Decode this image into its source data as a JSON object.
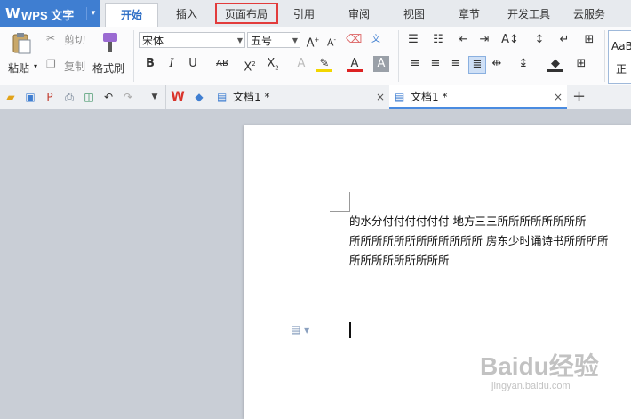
{
  "app": {
    "name": "WPS 文字",
    "logo_glyph": "W"
  },
  "menu_tabs": [
    {
      "label": "开始",
      "active": true
    },
    {
      "label": "插入"
    },
    {
      "label": "页面布局",
      "highlighted": true
    },
    {
      "label": "引用"
    },
    {
      "label": "审阅"
    },
    {
      "label": "视图"
    },
    {
      "label": "章节"
    },
    {
      "label": "开发工具"
    },
    {
      "label": "云服务"
    }
  ],
  "ribbon": {
    "paste": "粘贴",
    "cut": "剪切",
    "copy": "复制",
    "format_painter": "格式刷",
    "font_name": "宋体",
    "font_size": "五号",
    "style_preview": "AaB",
    "style_preview_2": "正"
  },
  "doc_tabs": [
    {
      "label": "文档1 *"
    },
    {
      "label": "文档1 *",
      "active": true
    }
  ],
  "document": {
    "lines": [
      "的水分付付付付付付  地方三三所所所所所所所所",
      "所所所所所所所所所所所所 房东少时诵诗书所所所所",
      "所所所所所所所所所"
    ]
  },
  "watermark": {
    "main": "Baidu经验",
    "sub": "jingyan.baidu.com"
  },
  "colors": {
    "accent": "#3f7ed1",
    "highlight_red": "#e23b3b",
    "wps_red": "#d9342b"
  }
}
